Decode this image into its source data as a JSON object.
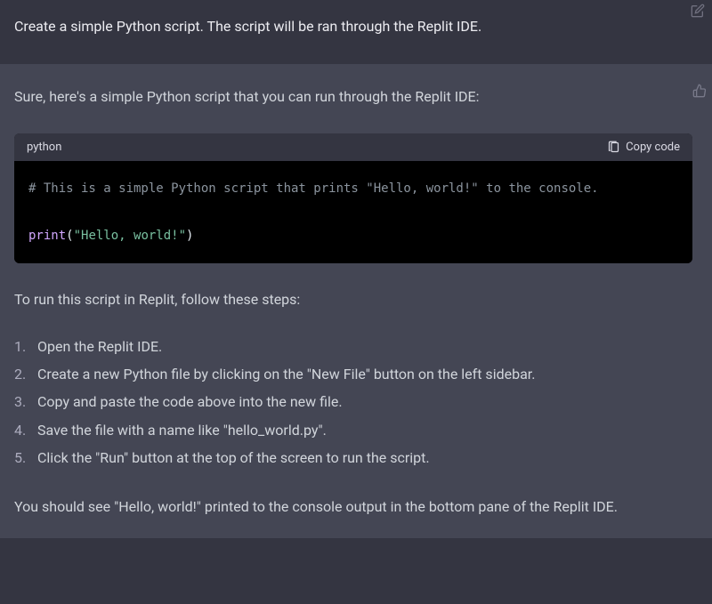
{
  "user": {
    "prompt": "Create a simple Python script. The script will be ran through the Replit IDE."
  },
  "assistant": {
    "intro": "Sure, here's a simple Python script that you can run through the Replit IDE:",
    "code": {
      "language": "python",
      "copy_label": "Copy code",
      "comment": "# This is a simple Python script that prints \"Hello, world!\" to the console.",
      "fn": "print",
      "open": "(",
      "string": "\"Hello, world!\"",
      "close": ")"
    },
    "instructions_lead": "To run this script in Replit, follow these steps:",
    "steps": [
      "Open the Replit IDE.",
      "Create a new Python file by clicking on the \"New File\" button on the left sidebar.",
      "Copy and paste the code above into the new file.",
      "Save the file with a name like \"hello_world.py\".",
      "Click the \"Run\" button at the top of the screen to run the script."
    ],
    "outro": "You should see \"Hello, world!\" printed to the console output in the bottom pane of the Replit IDE."
  }
}
